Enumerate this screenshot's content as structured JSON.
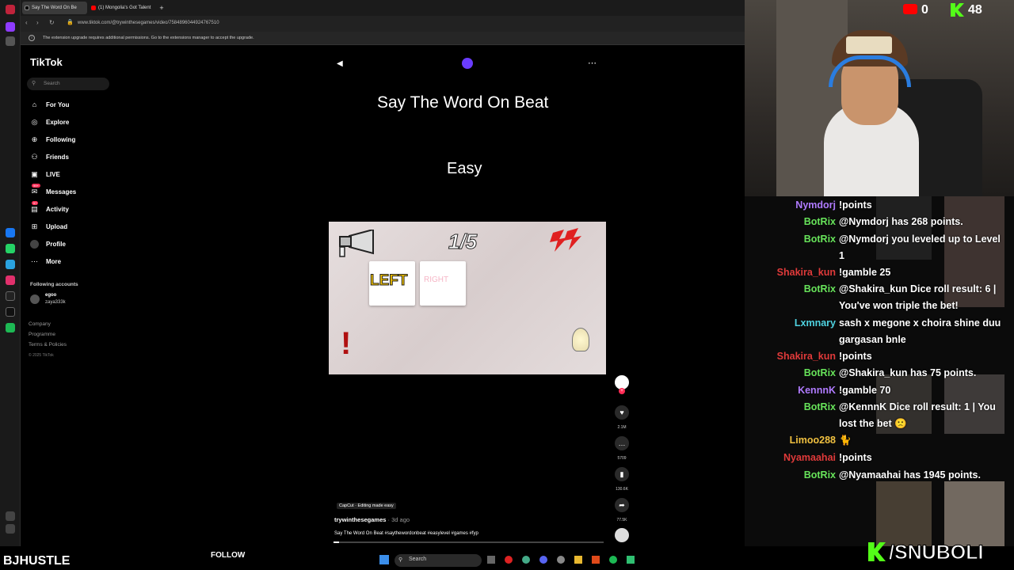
{
  "browser": {
    "tabs": [
      {
        "label": "Say The Word On Be"
      },
      {
        "label": "(1) Mongolia's Got Talent"
      }
    ],
    "url": "www.tiktok.com/@trywinthesegames/video/7584896044924767510",
    "info_bar": "The extension upgrade requires additional permissions. Go to the extensions manager to accept the upgrade."
  },
  "tiktok": {
    "logo": "TikTok",
    "search_placeholder": "Search",
    "nav": [
      {
        "label": "For You",
        "icon": "home-icon"
      },
      {
        "label": "Explore",
        "icon": "compass-icon"
      },
      {
        "label": "Following",
        "icon": "following-icon"
      },
      {
        "label": "Friends",
        "icon": "friends-icon"
      },
      {
        "label": "LIVE",
        "icon": "live-icon"
      },
      {
        "label": "Messages",
        "icon": "messages-icon",
        "badge": "99+"
      },
      {
        "label": "Activity",
        "icon": "activity-icon",
        "badge": "57"
      },
      {
        "label": "Upload",
        "icon": "upload-icon"
      },
      {
        "label": "Profile",
        "icon": "profile-icon"
      },
      {
        "label": "More",
        "icon": "more-icon"
      }
    ],
    "following_header": "Following accounts",
    "following_account": {
      "name": "egoo",
      "handle": "zaya333k"
    },
    "footer_links": [
      "Company",
      "Programme",
      "Terms & Policies"
    ],
    "copyright": "© 2025 TikTok"
  },
  "video": {
    "title": "Say The Word On Beat",
    "subtitle": "Easy",
    "counter": "1/5",
    "card1": "LEFT",
    "card2": "RIGHT",
    "capcut_tag": "CapCut · Editing made easy",
    "author": "trywinthesegames",
    "author_time": " · 3d ago",
    "description": "Say The Word On Beat #saythewordonbeat #easylevel #games #fyp",
    "likes": "2.1M",
    "comments": "5709",
    "saves": "130.6K",
    "shares": "77.5K"
  },
  "overlay": {
    "youtube_viewers": "0",
    "kick_viewers": "48",
    "streamer_name": "BJHUSTLE",
    "follow_label": "FOLLOW",
    "kick_handle": "/SNUBOLI"
  },
  "chat": [
    {
      "user": "Nymdorj",
      "color": "#b07bff",
      "msg": "!points"
    },
    {
      "user": "BotRix",
      "color": "#67e35a",
      "msg": "@Nymdorj has 268 points."
    },
    {
      "user": "BotRix",
      "color": "#67e35a",
      "msg": "@Nymdorj you leveled up to Level 1"
    },
    {
      "user": "Shakira_kun",
      "color": "#e03a3a",
      "msg": "!gamble 25"
    },
    {
      "user": "BotRix",
      "color": "#67e35a",
      "msg": "@Shakira_kun Dice roll result: 6 | You've won triple the bet!"
    },
    {
      "user": "Lxmnary",
      "color": "#4fd2e0",
      "msg": "sash x megone x choira shine duu gargasan bnle"
    },
    {
      "user": "Shakira_kun",
      "color": "#e03a3a",
      "msg": "!points"
    },
    {
      "user": "BotRix",
      "color": "#67e35a",
      "msg": "@Shakira_kun has 75 points."
    },
    {
      "user": "KennnK",
      "color": "#b07bff",
      "msg": "!gamble 70"
    },
    {
      "user": "BotRix",
      "color": "#67e35a",
      "msg": "@KennnK Dice roll result: 1 | You lost the bet 🙁"
    },
    {
      "user": "Limoo288",
      "color": "#f0c040",
      "msg": ""
    },
    {
      "user": "Nyamaahai",
      "color": "#e03a3a",
      "msg": "!points"
    },
    {
      "user": "BotRix",
      "color": "#67e35a",
      "msg": "@Nyamaahai has 1945 points."
    }
  ],
  "taskbar": {
    "search_label": "Search"
  },
  "colors": {
    "tiktok_red": "#fe2c55",
    "botrix": "#67e35a",
    "kick_green": "#53fc18"
  }
}
